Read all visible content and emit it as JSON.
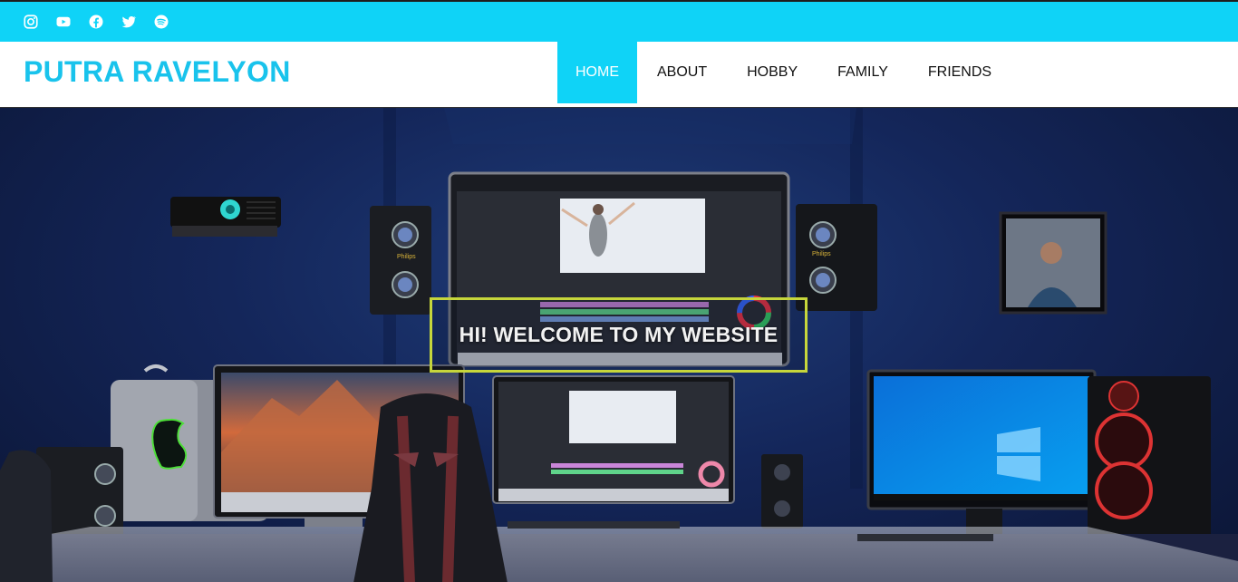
{
  "social_icons": [
    {
      "name": "instagram-icon"
    },
    {
      "name": "youtube-icon"
    },
    {
      "name": "facebook-icon"
    },
    {
      "name": "twitter-icon"
    },
    {
      "name": "spotify-icon"
    }
  ],
  "colors": {
    "accent": "#0fd3f7",
    "brand_text": "#19c3ec",
    "welcome_border": "#c6d63b"
  },
  "header": {
    "brand": "PUTRA RAVELYON"
  },
  "nav": {
    "items": [
      {
        "label": "HOME",
        "active": true
      },
      {
        "label": "ABOUT",
        "active": false
      },
      {
        "label": "HOBBY",
        "active": false
      },
      {
        "label": "FAMILY",
        "active": false
      },
      {
        "label": "FRIENDS",
        "active": false
      }
    ]
  },
  "hero": {
    "welcome": "HI! WELCOME TO MY WEBSITE",
    "speaker_brand": "Philips"
  }
}
